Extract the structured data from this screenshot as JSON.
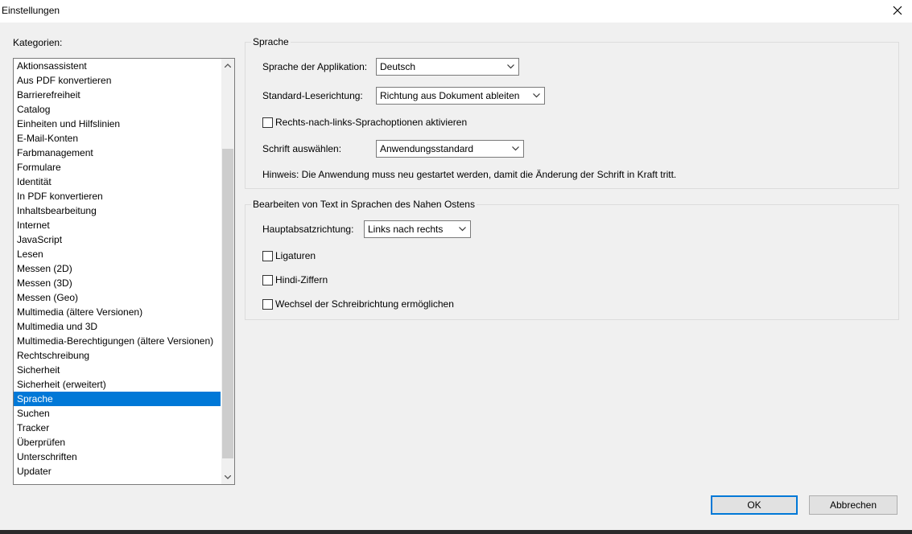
{
  "window": {
    "title": "Einstellungen"
  },
  "categories": {
    "label": "Kategorien:",
    "items": [
      "Aktionsassistent",
      "Aus PDF konvertieren",
      "Barrierefreiheit",
      "Catalog",
      "Einheiten und Hilfslinien",
      "E-Mail-Konten",
      "Farbmanagement",
      "Formulare",
      "Identität",
      "In PDF konvertieren",
      "Inhaltsbearbeitung",
      "Internet",
      "JavaScript",
      "Lesen",
      "Messen (2D)",
      "Messen (3D)",
      "Messen (Geo)",
      "Multimedia (ältere Versionen)",
      "Multimedia und 3D",
      "Multimedia-Berechtigungen (ältere Versionen)",
      "Rechtschreibung",
      "Sicherheit",
      "Sicherheit (erweitert)",
      "Sprache",
      "Suchen",
      "Tracker",
      "Überprüfen",
      "Unterschriften",
      "Updater"
    ],
    "selected": "Sprache"
  },
  "sprache": {
    "legend": "Sprache",
    "app_language_label": "Sprache der Applikation:",
    "app_language_value": "Deutsch",
    "reading_direction_label": "Standard-Leserichtung:",
    "reading_direction_value": "Richtung aus Dokument ableiten",
    "rtl_options_label": "Rechts-nach-links-Sprachoptionen aktivieren",
    "rtl_options_checked": false,
    "font_label": "Schrift auswählen:",
    "font_value": "Anwendungsstandard",
    "hint": "Hinweis: Die Anwendung muss neu gestartet werden, damit die Änderung der Schrift in Kraft tritt."
  },
  "middle_east": {
    "legend": "Bearbeiten von Text in Sprachen des Nahen Ostens",
    "paragraph_direction_label": "Hauptabsatzrichtung:",
    "paragraph_direction_value": "Links nach rechts",
    "ligatures_label": "Ligaturen",
    "hindi_digits_label": "Hindi-Ziffern",
    "writing_direction_label": "Wechsel der Schreibrichtung ermöglichen"
  },
  "buttons": {
    "ok": "OK",
    "cancel": "Abbrechen"
  },
  "colors": {
    "selection": "#0078d7",
    "dialog_bg": "#f0f0f0"
  }
}
